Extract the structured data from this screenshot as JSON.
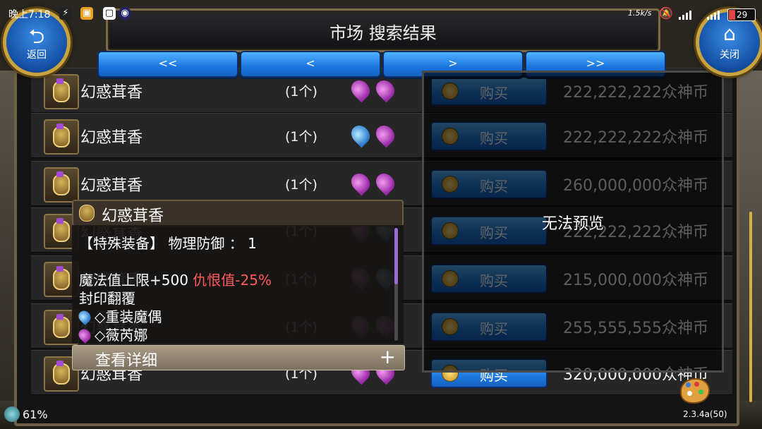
{
  "status_bar": {
    "time": "晚上7:18",
    "net_speed": "1.5k/s",
    "battery": "29"
  },
  "header": {
    "title": "市场 搜索结果",
    "back_label": "返回",
    "close_label": "关闭"
  },
  "pagination": {
    "first": "<<",
    "prev": "<",
    "next": ">",
    "last": ">>"
  },
  "listings": [
    {
      "name": "幻惑茸香",
      "count": "(1个)",
      "stones": [
        "purple",
        "purple"
      ],
      "buy_label": "购买",
      "price": "222,222,222众神币"
    },
    {
      "name": "幻惑茸香",
      "count": "(1个)",
      "stones": [
        "blue",
        "purple"
      ],
      "buy_label": "购买",
      "price": "222,222,222众神币"
    },
    {
      "name": "幻惑茸香",
      "count": "(1个)",
      "stones": [
        "purple",
        "purple"
      ],
      "buy_label": "购买",
      "price": "260,000,000众神币"
    },
    {
      "name": "幻惑茸香",
      "count": "(1个)",
      "stones": [
        "purple",
        "blue"
      ],
      "buy_label": "购买",
      "price": "222,222,222众神币"
    },
    {
      "name": "幻惑茸香",
      "count": "(1个)",
      "stones": [
        "purple",
        "blue"
      ],
      "buy_label": "购买",
      "price": "215,000,000众神币"
    },
    {
      "name": "幻惑茸香",
      "count": "(1个)",
      "stones": [
        "purple",
        "purple"
      ],
      "buy_label": "购买",
      "price": "255,555,555众神币"
    },
    {
      "name": "幻惑茸香",
      "count": "(1个)",
      "stones": [
        "purple",
        "purple"
      ],
      "buy_label": "购买",
      "price": "320,000,000众神币"
    }
  ],
  "preview": {
    "message": "无法预览"
  },
  "tooltip": {
    "item_name": "幻惑茸香",
    "line1": "【特殊装备】 物理防御 ： 1",
    "line2_prefix": "魔法值上限+500 ",
    "line2_hate": "仇恨值",
    "line2_hate_value": "-25%",
    "line3": "封印翻覆",
    "gem1": "◇重装魔偶",
    "gem2": "◇薇芮娜",
    "detail_label": "查看详细",
    "plus": "+"
  },
  "footer": {
    "percent": "61%",
    "version": "2.3.4a(50)"
  },
  "colors": {
    "button_blue": "#1f7be0",
    "frame_gold": "#c9a33f",
    "hate_red": "#ff5a5a",
    "stone_purple": "#9a2aa8",
    "stone_blue": "#2d7bd0"
  }
}
